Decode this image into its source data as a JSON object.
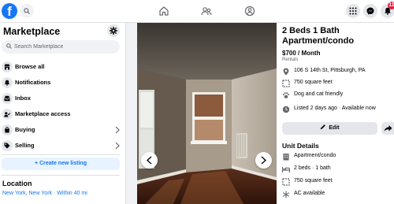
{
  "topbar": {
    "logo_letter": "f",
    "notif_count": "11",
    "nav_icons": [
      "home-icon",
      "groups-icon",
      "watch-icon"
    ],
    "right_icons": [
      "apps-grid-icon",
      "messenger-icon",
      "bell-icon"
    ]
  },
  "sidebar": {
    "title": "Marketplace",
    "search_placeholder": "Search Marketplace",
    "items": [
      {
        "label": "Browse all",
        "icon": "storefront-icon"
      },
      {
        "label": "Notifications",
        "icon": "bell-icon"
      },
      {
        "label": "Inbox",
        "icon": "inbox-icon"
      },
      {
        "label": "Marketplace access",
        "icon": "access-icon"
      },
      {
        "label": "Buying",
        "icon": "shopping-bag-icon"
      },
      {
        "label": "Selling",
        "icon": "tag-icon"
      }
    ],
    "create_button": "+ Create new listing",
    "location_title": "Location",
    "location_value": "New York, New York · Within 40 mi"
  },
  "listing": {
    "title": "2 Beds 1 Bath Apartment/condo",
    "price": "$700 / Month",
    "category": "Rentals",
    "address": "106 S 14th St, Pittsburgh, PA",
    "size": "750 square feet",
    "pets": "Dog and cat friendly",
    "listed": "Listed 2 days ago · Available now",
    "edit_label": "Edit",
    "unit_details_title": "Unit Details",
    "unit_details": [
      {
        "label": "Apartment/condo",
        "icon": "building-icon"
      },
      {
        "label": "2 beds · 1 bath",
        "icon": "bed-icon"
      },
      {
        "label": "750 square feet",
        "icon": "area-icon"
      },
      {
        "label": "AC available",
        "icon": "snowflake-icon"
      }
    ]
  },
  "colors": {
    "brand": "#1877f2",
    "notif": "#e41e3f",
    "background": "#f0f2f5"
  }
}
